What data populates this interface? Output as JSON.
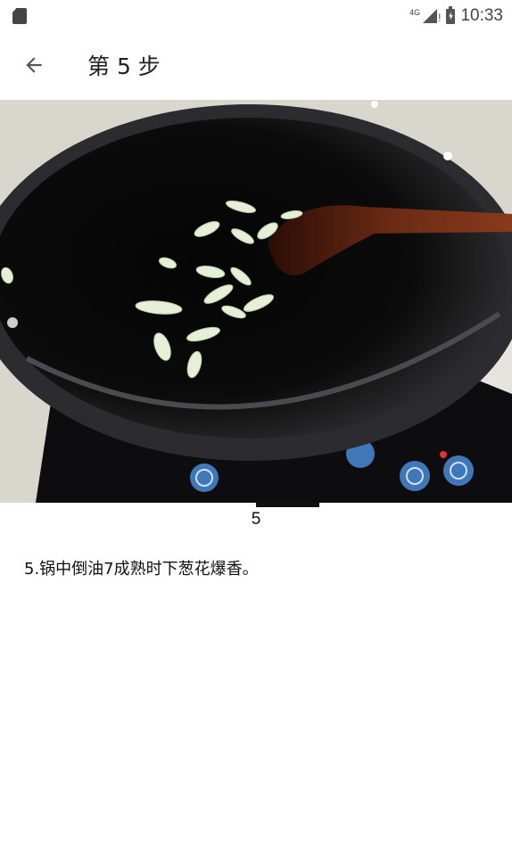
{
  "status_bar": {
    "network": "4G",
    "time": "10:33",
    "icons": [
      "sd-card-icon",
      "signal-icon",
      "battery-charging-icon"
    ]
  },
  "app_bar": {
    "back_icon": "arrow-left-icon",
    "title": "第 5 步"
  },
  "step": {
    "image_alt": "锅中葱花",
    "page_number": "5",
    "description": "5.锅中倒油7成熟时下葱花爆香。"
  }
}
